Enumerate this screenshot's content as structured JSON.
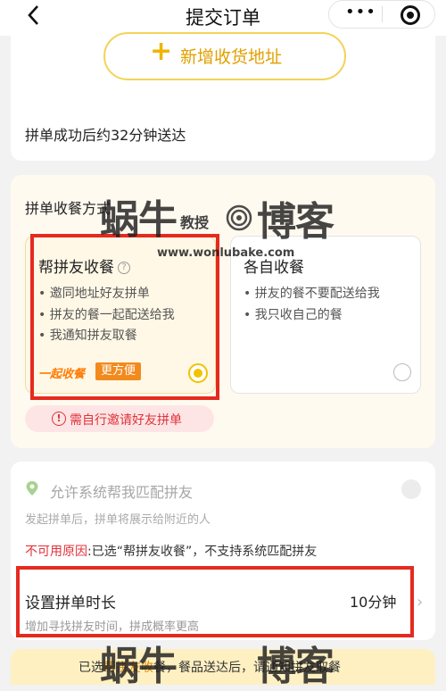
{
  "nav": {
    "back_icon": "chevron-left-icon",
    "title": "提交订单",
    "more_icon": "more-dots-icon",
    "close_icon": "target-circle-icon"
  },
  "address": {
    "add_label": "新增收货地址",
    "plus_icon": "plus-icon"
  },
  "delivery": {
    "arrive_text": "拼单成功后约32分钟送达"
  },
  "method": {
    "title": "拼单收餐方式",
    "option_a": {
      "title": "帮拼友收餐",
      "help_icon": "question-circle-icon",
      "bullets": [
        "• 邀同地址好友拼单",
        "• 拼友的餐一起配送给我",
        "• 我通知拼友取餐"
      ],
      "tag1": "一起收餐",
      "tag2": "更方便",
      "selected": true
    },
    "option_b": {
      "title": "各自收餐",
      "bullets": [
        "• 拼友的餐不要配送给我",
        "• 我只收自己的餐"
      ],
      "selected": false
    },
    "warning": "需自行邀请好友拼单",
    "warning_icon": "exclamation-circle-icon"
  },
  "match": {
    "icon": "location-pin-icon",
    "title": "允许系统帮我匹配拼友",
    "desc": "发起拼单后，拼单将展示给附近的人",
    "reason_key": "不可用原因",
    "reason_text": ":已选“帮拼友收餐”，不支持系统匹配拼友",
    "enabled": false
  },
  "duration": {
    "title": "设置拼单时长",
    "value": "10分钟",
    "desc": "增加寻找拼友时间，拼成概率更高",
    "chevron_icon": "chevron-right-icon"
  },
  "bottom": {
    "prefix": "已选",
    "mid": "帮拼友收",
    "rest": "餐，餐品送达后，请通知拼友取餐"
  },
  "watermark": {
    "part1": "蜗牛",
    "part2": "教授",
    "part3": "博客",
    "url": "www.wonlubake.com"
  },
  "colors": {
    "accent": "#f2c200",
    "warning": "#e0323a",
    "highlight_box": "#e52a1f"
  }
}
